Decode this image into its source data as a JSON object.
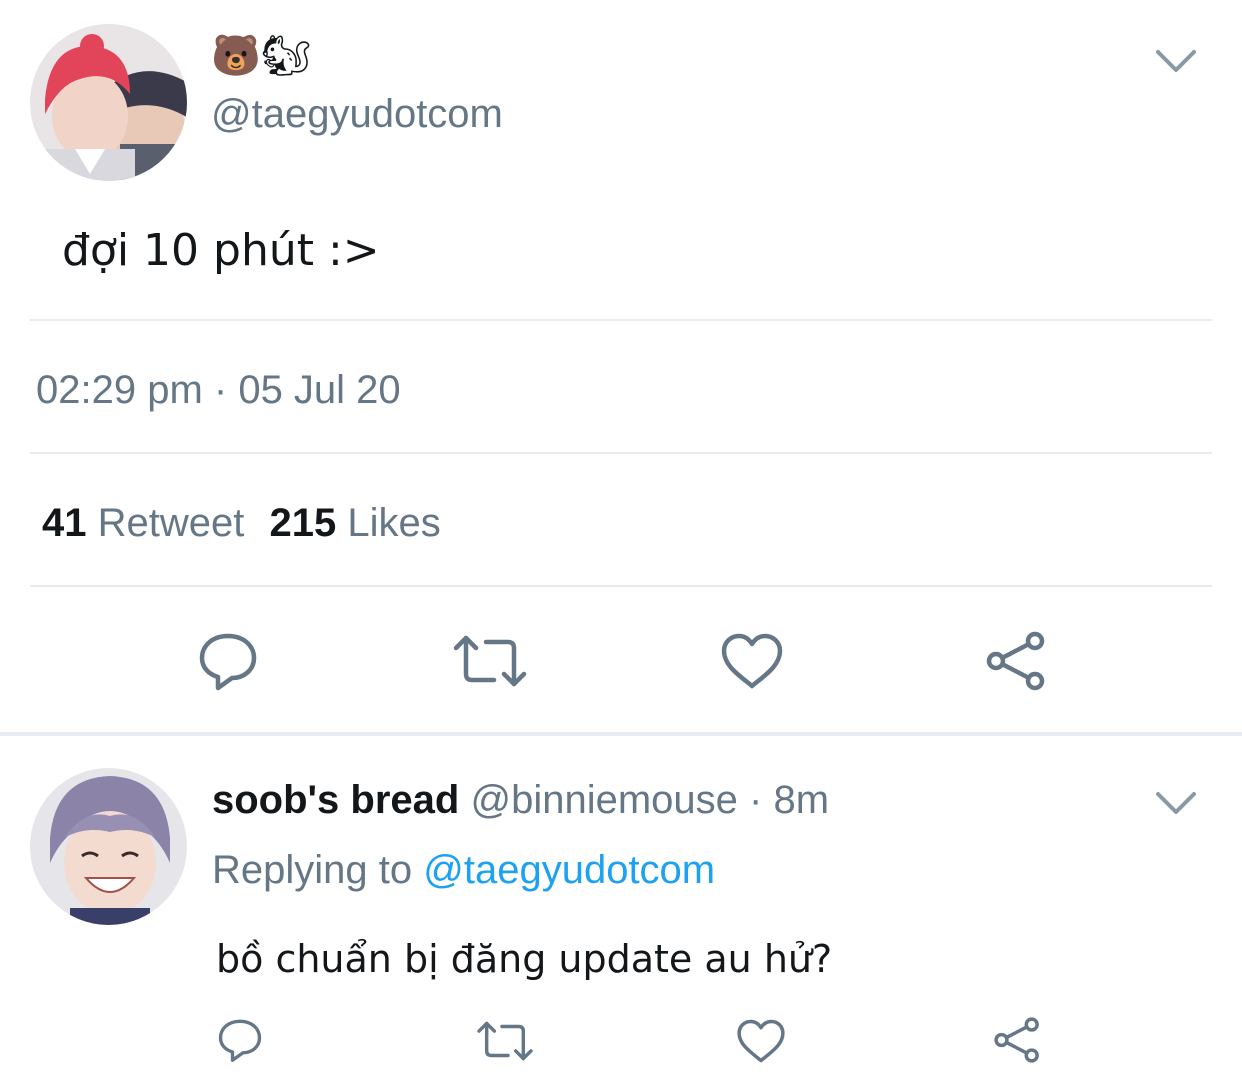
{
  "main_tweet": {
    "display_name_emoji": "🐻🐿",
    "handle": "@taegyudotcom",
    "text": "đợi 10 phút :>",
    "timestamp": "02:29 pm · 05 Jul 20",
    "retweet_count": "41",
    "retweet_label": "Retweet",
    "like_count": "215",
    "like_label": "Likes",
    "menu_icon": "chevron-down-icon",
    "actions": [
      "reply-icon",
      "retweet-icon",
      "like-icon",
      "share-icon"
    ]
  },
  "reply_tweet": {
    "display_name": "soob's bread",
    "handle": "@binniemouse",
    "separator": "·",
    "time_ago": "8m",
    "replying_prefix": "Replying to",
    "replying_handle": "@taegyudotcom",
    "text": "bồ chuẩn bị đăng update au hử?",
    "menu_icon": "chevron-down-icon",
    "actions": [
      "reply-icon",
      "retweet-icon",
      "like-icon",
      "share-icon"
    ]
  },
  "colors": {
    "text_primary": "#14171a",
    "text_muted": "#657786",
    "link_blue": "#1da1f2",
    "divider": "#e6ecf0"
  }
}
